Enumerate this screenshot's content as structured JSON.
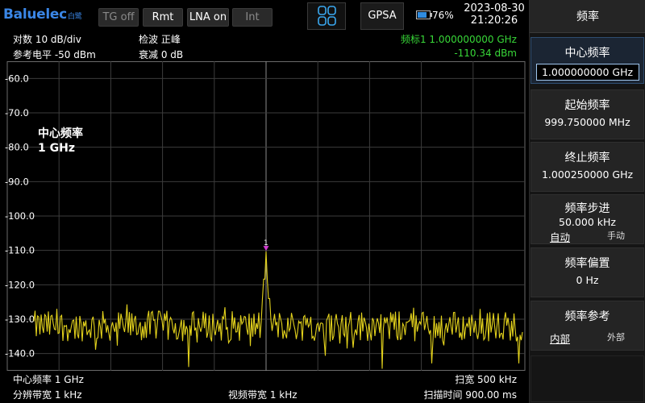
{
  "brand": {
    "name": "Baluelec",
    "sub": "白鹭"
  },
  "toolbar": {
    "tg": "TG off",
    "rmt": "Rmt",
    "lna": "LNA on",
    "int": "Int",
    "mode": "GPSA",
    "battery": "76%",
    "battery_level": 0.76,
    "date": "2023-08-30",
    "time": "21:20:26"
  },
  "info": {
    "scale": "对数 10 dB/div",
    "ref_level": "参考电平 -50 dBm",
    "detector": "检波 正峰",
    "atten": "衰减 0 dB",
    "marker": "频标1  1.000000000 GHz",
    "marker_value": "-110.34 dBm",
    "marker_num": "1",
    "center_freq": "中心频率 1 GHz",
    "span": "扫宽 500 kHz",
    "rbw": "分辨带宽 1 kHz",
    "vbw": "视频带宽 1 kHz",
    "sweep": "扫描时间 900.00 ms"
  },
  "overlay": {
    "line1": "中心频率",
    "line2": "1 GHz"
  },
  "panel": {
    "title": "频率",
    "center": {
      "label": "中心频率",
      "value": "1.000000000 GHz"
    },
    "start": {
      "label": "起始频率",
      "value": "999.750000 MHz"
    },
    "stop": {
      "label": "终止频率",
      "value": "1.000250000 GHz"
    },
    "step": {
      "label": "频率步进",
      "value": "50.000 kHz",
      "opt_auto": "自动",
      "opt_manual": "手动"
    },
    "offset": {
      "label": "频率偏置",
      "value": "0 Hz"
    },
    "ref": {
      "label": "频率参考",
      "opt_int": "内部",
      "opt_ext": "外部"
    }
  },
  "chart_data": {
    "type": "line",
    "ylabels": [
      "-60.0",
      "-70.0",
      "-80.0",
      "-90.0",
      "-100.0",
      "-110.0",
      "-120.0",
      "-130.0",
      "-140.0"
    ],
    "ylim": [
      -145,
      -55
    ],
    "xlim_ghz": [
      0.99975,
      1.00025
    ],
    "noise_floor_dbm": -132,
    "peak": {
      "x_ghz": 1.0,
      "y_dbm": -110.34
    },
    "grid": true,
    "trace_color": "#e3d21c",
    "marker_color": "#d23cd2"
  },
  "colors": {
    "accent": "#2f8ce0",
    "marker_green": "#38d838",
    "trace": "#e3d21c"
  }
}
